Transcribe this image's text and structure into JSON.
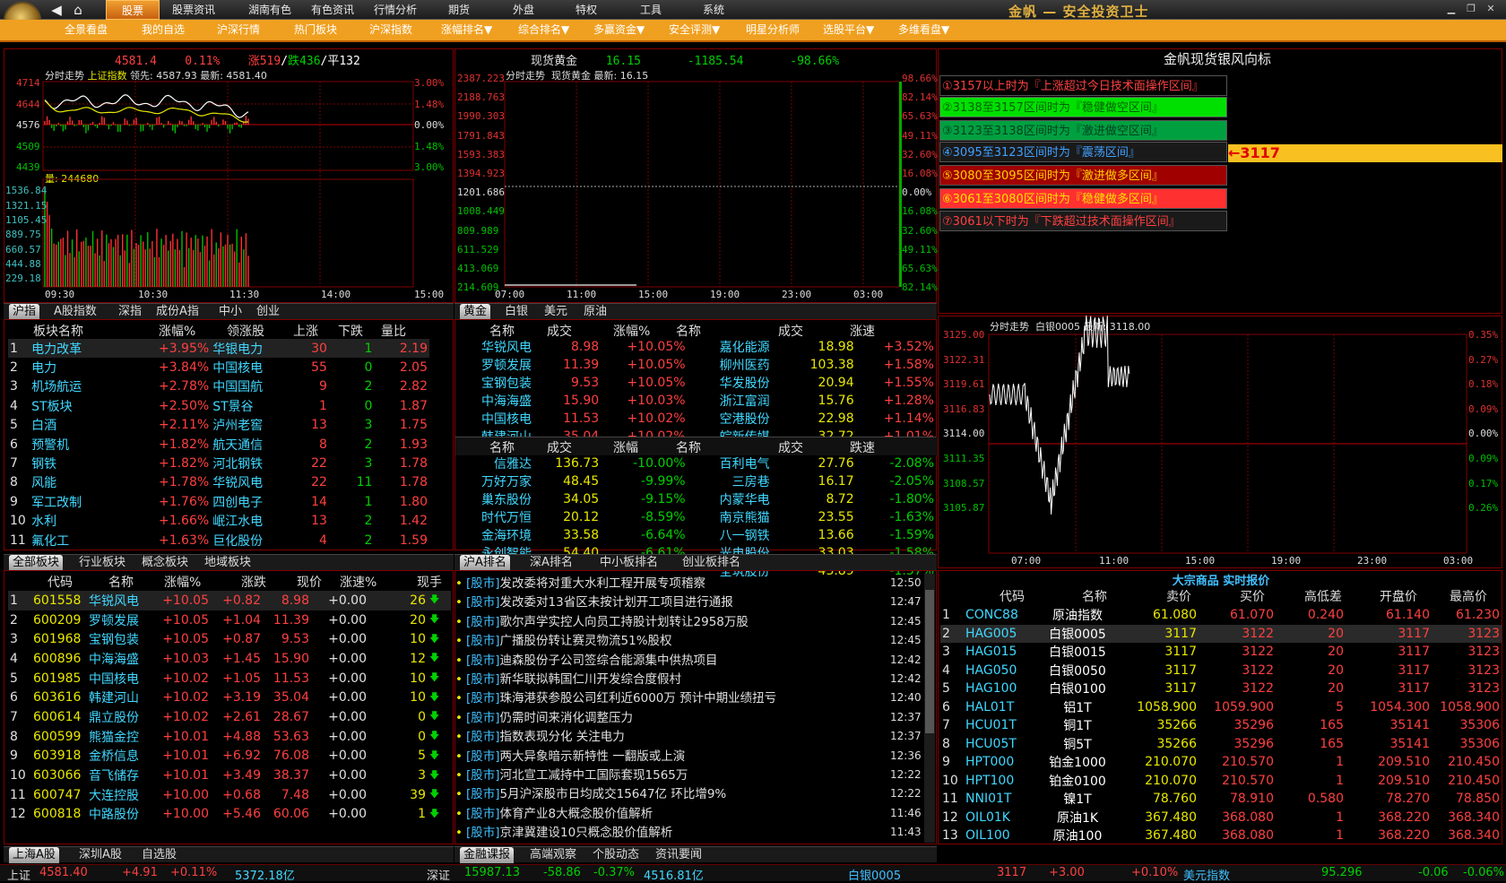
{
  "app": {
    "brand": "金帆 — 安全投资卫士"
  },
  "menu": [
    "股票",
    "股票资讯",
    "湖南有色",
    "有色资讯",
    "行情分析",
    "期货",
    "外盘",
    "特权",
    "工具",
    "系统"
  ],
  "submenu": [
    "全景看盘",
    "我的自选",
    "沪深行情",
    "热门板块",
    "沪深指数",
    "涨幅排名▼",
    "综合排名▼",
    "多赢资金▼",
    "安全评测▼",
    "明星分析师",
    "选股平台▼",
    "多维看盘▼"
  ],
  "index_panel": {
    "price": "4581.4",
    "pct": "0.11%",
    "up": "涨519",
    "down": "跌436",
    "flat": "平132",
    "title": "分时走势",
    "name": "上证指数",
    "lead": "领先: 4587.93",
    "latest": "最新: 4581.40",
    "volume": "量: 244680",
    "yl": [
      "4714",
      "4644",
      "4576",
      "4509",
      "4439"
    ],
    "yr": [
      "3.00%",
      "1.48%",
      "0.00%",
      "1.48%",
      "3.00%"
    ],
    "vl": [
      "1536.84",
      "1321.15",
      "1105.45",
      "889.75",
      "660.57",
      "444.88",
      "229.18"
    ],
    "xt": [
      "09:30",
      "10:30",
      "11:30",
      "14:00",
      "15:00"
    ]
  },
  "gold_panel": {
    "name": "现货黄金",
    "price": "16.15",
    "change": "-1185.54",
    "pct": "-98.66%",
    "title": "分时走势",
    "sub": "现货黄金",
    "latest": "最新: 16.15",
    "yl": [
      "2387.223",
      "2188.763",
      "1990.303",
      "1791.843",
      "1593.383",
      "1394.923",
      "1201.686",
      "1008.449",
      "809.989",
      "611.529",
      "413.069",
      "214.609"
    ],
    "yr": [
      "98.66%",
      "82.14%",
      "65.63%",
      "49.11%",
      "32.60%",
      "16.08%",
      "0.00%",
      "16.08%",
      "32.60%",
      "49.11%",
      "65.63%",
      "82.14%"
    ],
    "xt": [
      "07:00",
      "11:00",
      "15:00",
      "19:00",
      "23:00",
      "03:00"
    ]
  },
  "strategy": {
    "title": "金帆现货银风向标",
    "items": [
      "①3157以上时为『上涨超过今日技术面操作区间』",
      "②3138至3157区间时为『稳健做空区间』",
      "③3123至3138区间时为『激进做空区间』",
      "④3095至3123区间时为『震荡区间』",
      "⑤3080至3095区间时为『激进做多区间』",
      "⑥3061至3080区间时为『稳健做多区间』",
      "⑦3061以下时为『下跌超过技术面操作区间』"
    ],
    "marker": "←3117"
  },
  "silver_panel": {
    "title": "分时走势",
    "name": "白银0005",
    "latest": "最新: 3118.00",
    "yl": [
      "3125.00",
      "3122.31",
      "3119.61",
      "3116.83",
      "3114.00",
      "3111.35",
      "3108.57",
      "3105.87"
    ],
    "yr": [
      "0.35%",
      "0.27%",
      "0.18%",
      "0.09%",
      "0.00%",
      "0.09%",
      "0.17%",
      "0.26%"
    ],
    "xt": [
      "07:00",
      "11:00",
      "15:00",
      "19:00",
      "23:00",
      "03:00"
    ]
  },
  "sector_tabs": [
    "沪指",
    "A股指数",
    "深指",
    "成份A指",
    "中小",
    "创业"
  ],
  "sector_headers": [
    "板块名称",
    "涨幅%",
    "领涨股",
    "上涨",
    "下跌",
    "量比"
  ],
  "sectors": [
    [
      "1",
      "电力改革",
      "+3.95%",
      "华银电力",
      "30",
      "1",
      "2.19"
    ],
    [
      "2",
      "电力",
      "+3.84%",
      "中国核电",
      "55",
      "0",
      "2.05"
    ],
    [
      "3",
      "机场航运",
      "+2.78%",
      "中国国航",
      "9",
      "2",
      "2.82"
    ],
    [
      "4",
      "ST板块",
      "+2.50%",
      "ST景谷",
      "1",
      "0",
      "1.87"
    ],
    [
      "5",
      "白酒",
      "+2.11%",
      "泸州老窖",
      "13",
      "3",
      "1.75"
    ],
    [
      "6",
      "预警机",
      "+1.82%",
      "航天通信",
      "8",
      "2",
      "1.93"
    ],
    [
      "7",
      "钢铁",
      "+1.82%",
      "河北钢铁",
      "22",
      "3",
      "1.78"
    ],
    [
      "8",
      "风能",
      "+1.78%",
      "华锐风电",
      "22",
      "11",
      "1.78"
    ],
    [
      "9",
      "军工改制",
      "+1.76%",
      "四创电子",
      "14",
      "1",
      "1.80"
    ],
    [
      "10",
      "水利",
      "+1.66%",
      "岷江水电",
      "13",
      "2",
      "1.42"
    ],
    [
      "11",
      "氟化工",
      "+1.63%",
      "巨化股份",
      "4",
      "2",
      "1.59"
    ]
  ],
  "commodity_tabs": [
    "黄金",
    "白银",
    "美元",
    "原油"
  ],
  "movers_up_headers": [
    "名称",
    "成交",
    "涨幅%",
    "名称",
    "成交",
    "涨速"
  ],
  "movers_up": [
    [
      "华锐风电",
      "8.98",
      "+10.05%",
      "嘉化能源",
      "18.98",
      "+3.52%"
    ],
    [
      "罗顿发展",
      "11.39",
      "+10.05%",
      "柳州医药",
      "103.38",
      "+1.58%"
    ],
    [
      "宝钢包装",
      "9.53",
      "+10.05%",
      "华发股份",
      "20.94",
      "+1.55%"
    ],
    [
      "中海海盛",
      "15.90",
      "+10.03%",
      "浙江富润",
      "15.76",
      "+1.28%"
    ],
    [
      "中国核电",
      "11.53",
      "+10.02%",
      "空港股份",
      "22.98",
      "+1.14%"
    ],
    [
      "韩建河山",
      "35.04",
      "+10.02%",
      "皖新传媒",
      "32.72",
      "+1.01%"
    ]
  ],
  "movers_down_headers": [
    "名称",
    "成交",
    "涨幅",
    "名称",
    "成交",
    "跌速"
  ],
  "movers_down": [
    [
      "信雅达",
      "136.73",
      "-10.00%",
      "百利电气",
      "27.76",
      "-2.08%"
    ],
    [
      "万好万家",
      "48.45",
      "-9.99%",
      "三房巷",
      "16.17",
      "-2.05%"
    ],
    [
      "巢东股份",
      "34.05",
      "-9.15%",
      "内蒙华电",
      "8.72",
      "-1.80%"
    ],
    [
      "时代万恒",
      "20.12",
      "-8.59%",
      "南京熊猫",
      "23.55",
      "-1.63%"
    ],
    [
      "金海环境",
      "33.58",
      "-6.64%",
      "八一钢铁",
      "13.66",
      "-1.59%"
    ],
    [
      "永创智能",
      "54.40",
      "-6.61%",
      "光电股份",
      "33.03",
      "-1.58%"
    ],
    [
      "",
      "",
      "",
      "全筑股份",
      "43.89",
      "-1.57%"
    ]
  ],
  "board_tabs": [
    "全部板块",
    "行业板块",
    "概念板块",
    "地域板块"
  ],
  "stock_headers": [
    "代码",
    "名称",
    "涨幅%",
    "涨跌",
    "现价",
    "涨速%",
    "现手"
  ],
  "stocks": [
    [
      "1",
      "601558",
      "华锐风电",
      "+10.05",
      "+0.82",
      "8.98",
      "+0.00",
      "26"
    ],
    [
      "2",
      "600209",
      "罗顿发展",
      "+10.05",
      "+1.04",
      "11.39",
      "+0.00",
      "20"
    ],
    [
      "3",
      "601968",
      "宝钢包装",
      "+10.05",
      "+0.87",
      "9.53",
      "+0.00",
      "10"
    ],
    [
      "4",
      "600896",
      "中海海盛",
      "+10.03",
      "+1.45",
      "15.90",
      "+0.00",
      "12"
    ],
    [
      "5",
      "601985",
      "中国核电",
      "+10.02",
      "+1.05",
      "11.53",
      "+0.00",
      "10"
    ],
    [
      "6",
      "603616",
      "韩建河山",
      "+10.02",
      "+3.19",
      "35.04",
      "+0.00",
      "10"
    ],
    [
      "7",
      "600614",
      "鼎立股份",
      "+10.02",
      "+2.61",
      "28.67",
      "+0.00",
      "0"
    ],
    [
      "8",
      "600599",
      "熊猫金控",
      "+10.01",
      "+4.88",
      "53.63",
      "+0.00",
      "0"
    ],
    [
      "9",
      "603918",
      "金桥信息",
      "+10.01",
      "+6.92",
      "76.08",
      "+0.00",
      "5"
    ],
    [
      "10",
      "603066",
      "音飞储存",
      "+10.01",
      "+3.49",
      "38.37",
      "+0.00",
      "3"
    ],
    [
      "11",
      "600747",
      "大连控股",
      "+10.00",
      "+0.68",
      "7.48",
      "+0.00",
      "39"
    ],
    [
      "12",
      "600818",
      "中路股份",
      "+10.00",
      "+5.46",
      "60.06",
      "+0.00",
      "1"
    ]
  ],
  "rank_tabs": [
    "沪A排名",
    "深A排名",
    "中小板排名",
    "创业板排名"
  ],
  "news": [
    [
      "发改委将对重大水利工程开展专项稽察",
      "12:50"
    ],
    [
      "发改委对13省区未按计划开工项目进行通报",
      "12:47"
    ],
    [
      "歌尔声学实控人向员工持股计划转让2958万股",
      "12:45"
    ],
    [
      "广播股份转让赛灵物流51%股权",
      "12:45"
    ],
    [
      "迪森股份子公司签综合能源集中供热项目",
      "12:42"
    ],
    [
      "新华联拟韩国仁川开发综合度假村",
      "12:42"
    ],
    [
      "珠海港获参股公司红利近6000万 预计中期业绩扭亏",
      "12:40"
    ],
    [
      "仍需时间来消化调整压力",
      "12:37"
    ],
    [
      "指数表现分化 关注电力",
      "12:37"
    ],
    [
      "两大异象暗示新特性 一翻版或上演",
      "12:36"
    ],
    [
      "河北宣工减持中工国际套现1565万",
      "12:22"
    ],
    [
      "5月沪深股市日均成交15647亿 环比增9%",
      "12:22"
    ],
    [
      "体育产业8大概念股价值解析",
      "11:46"
    ],
    [
      "京津冀建设10只概念股价值解析",
      "11:43"
    ]
  ],
  "news_src": "[股市]",
  "news_tabs": [
    "金融课报",
    "高端观察",
    "个股动态",
    "资讯要闻"
  ],
  "commodity_title": "大宗商品 实时报价",
  "commodity_headers": [
    "代码",
    "名称",
    "卖价",
    "买价",
    "高低差",
    "开盘价",
    "最高价"
  ],
  "commodities": [
    [
      "1",
      "CONC88",
      "原油指数",
      "61.080",
      "61.070",
      "0.240",
      "61.140",
      "61.230"
    ],
    [
      "2",
      "HAG005",
      "白银0005",
      "3117",
      "3122",
      "20",
      "3117",
      "3123"
    ],
    [
      "3",
      "HAG015",
      "白银0015",
      "3117",
      "3122",
      "20",
      "3117",
      "3123"
    ],
    [
      "4",
      "HAG050",
      "白银0050",
      "3117",
      "3122",
      "20",
      "3117",
      "3123"
    ],
    [
      "5",
      "HAG100",
      "白银0100",
      "3117",
      "3122",
      "20",
      "3117",
      "3123"
    ],
    [
      "6",
      "HAL01T",
      "铝1T",
      "1058.900",
      "1059.900",
      "5",
      "1054.300",
      "1058.900"
    ],
    [
      "7",
      "HCU01T",
      "铜1T",
      "35266",
      "35296",
      "165",
      "35141",
      "35306"
    ],
    [
      "8",
      "HCU05T",
      "铜5T",
      "35266",
      "35296",
      "165",
      "35141",
      "35306"
    ],
    [
      "9",
      "HPT000",
      "铂金1000",
      "210.070",
      "210.570",
      "1",
      "209.510",
      "210.450"
    ],
    [
      "10",
      "HPT100",
      "铂金0100",
      "210.070",
      "210.570",
      "1",
      "209.510",
      "210.450"
    ],
    [
      "11",
      "NNI01T",
      "镍1T",
      "78.760",
      "78.910",
      "0.580",
      "78.270",
      "78.850"
    ],
    [
      "12",
      "OIL01K",
      "原油1K",
      "367.480",
      "368.080",
      "1",
      "368.220",
      "368.340"
    ],
    [
      "13",
      "OIL100",
      "原油100",
      "367.480",
      "368.080",
      "1",
      "368.220",
      "368.340"
    ]
  ],
  "bottom_tabs": [
    "上海A股",
    "深圳A股",
    "自选股"
  ],
  "status": {
    "sh_label": "上证",
    "sh_price": "4581.40",
    "sh_chg": "+4.91",
    "sh_pct": "+0.11%",
    "sh_amt": "5372.18亿",
    "sz_label": "深证",
    "sz_price": "15987.13",
    "sz_chg": "-58.86",
    "sz_pct": "-0.37%",
    "sz_amt": "4516.81亿",
    "ag_label": "白银0005",
    "ag_price": "3117",
    "ag_chg": "+3.00",
    "ag_pct": "+0.10%",
    "usd_label": "美元指数",
    "usd_price": "95.296",
    "usd_chg": "-0.06",
    "usd_pct": "-0.06%"
  }
}
